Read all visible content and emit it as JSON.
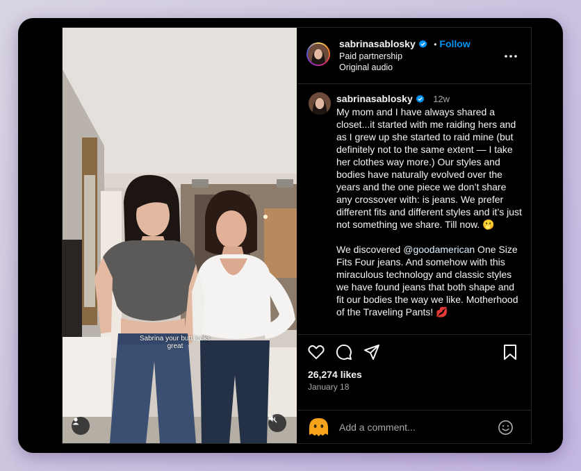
{
  "post": {
    "username": "sabrinasablosky",
    "follow_label": "Follow",
    "separator": "•",
    "paid_partnership": "Paid partnership",
    "audio": "Original audio",
    "time_ago": "12w",
    "caption_p1": "My mom and I have always shared a closet...it started with me raiding hers and as I grew up she started to raid mine (but definitely not to the same extent — I take her clothes way more.) Our styles and bodies have naturally evolved over the years and the one piece we don’t share any crossover with: is jeans. We prefer different fits and different styles and it’s just not something we share. Till now. 🫢",
    "caption_p2_mention": "@goodamerican",
    "caption_p2_rest": " One Size Fits Four jeans. And somehow with this miraculous technology and classic styles we have found jeans that both shape and fit our bodies the way we like. Motherhood of the Traveling Pants! 💋",
    "caption_p2_prefix": "We discovered ",
    "likes": "26,274 likes",
    "date": "January 18",
    "comment_placeholder": "Add a comment..."
  },
  "media": {
    "overlay_comment": "Sabrina your butt looks great"
  },
  "colors": {
    "accent": "#0095f6",
    "background": "#000000"
  }
}
